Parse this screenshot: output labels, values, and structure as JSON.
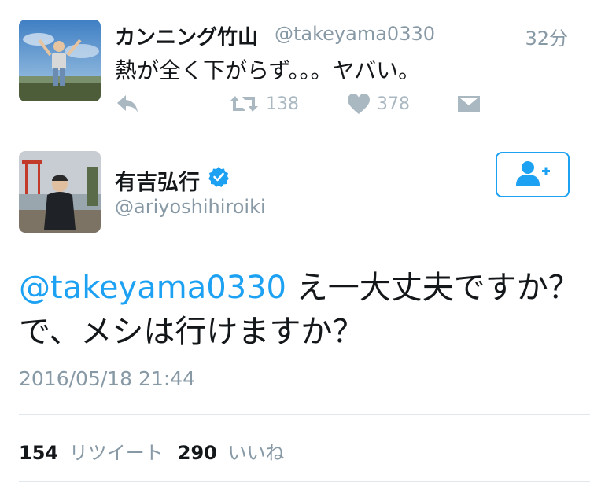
{
  "tweet1": {
    "name": "カンニング竹山",
    "handle": "@takeyama0330",
    "time": "32分",
    "text": "熱が全く下がらず。。。ヤバい。",
    "retweets": "138",
    "likes": "378",
    "icons": [
      "reply-icon",
      "retweet-icon",
      "heart-icon",
      "message-icon"
    ]
  },
  "tweet2": {
    "name": "有吉弘行",
    "handle": "@ariyoshihiroiki",
    "mention": "@takeyama0330",
    "text_line1": " え一大丈夫ですか？",
    "text_line2": "で、メシは行けますか？",
    "date": "2016/05/18 21:44",
    "retweet_count": "154",
    "retweet_label": "リツイート",
    "like_count": "290",
    "like_label": "いいね",
    "icons": [
      "verified-badge-icon",
      "follow-icon"
    ]
  },
  "colors": {
    "link": "#1da1f2",
    "muted": "#8899a6",
    "icon": "#aab8c2",
    "divider": "#e1e8ed"
  }
}
